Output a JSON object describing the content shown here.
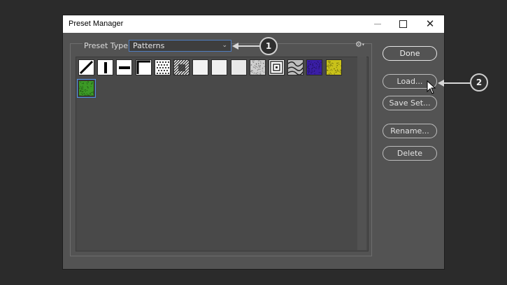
{
  "window": {
    "title": "Preset Manager",
    "controls": {
      "minimize": "–",
      "maximize": "□",
      "close": "✕"
    }
  },
  "preset": {
    "label": "Preset Type:",
    "value": "Patterns",
    "chevron": "⌄",
    "gear_icon": "⚙",
    "gear_dropdown": "▾"
  },
  "swatches": [
    {
      "name": "diagonal-line",
      "bg": "#ffffff",
      "style": "diag"
    },
    {
      "name": "vertical-bar",
      "bg": "#ffffff",
      "style": "vbar"
    },
    {
      "name": "horizontal-bar",
      "bg": "#ffffff",
      "style": "hbar"
    },
    {
      "name": "corner-frame",
      "bg": "#ffffff",
      "style": "corner"
    },
    {
      "name": "dots",
      "bg": "#ffffff",
      "style": "dots"
    },
    {
      "name": "diagonal-stripes",
      "bg": "#ffffff",
      "style": "stripes"
    },
    {
      "name": "light-noise-1",
      "bg": "#f3f3f3",
      "style": "plain"
    },
    {
      "name": "light-noise-2",
      "bg": "#f0f0f0",
      "style": "plain"
    },
    {
      "name": "light-noise-3",
      "bg": "#e8e8e8",
      "style": "plain"
    },
    {
      "name": "gray-noise",
      "bg": "#cfcfcf",
      "style": "noise"
    },
    {
      "name": "concentric-squares",
      "bg": "#ffffff",
      "style": "squares"
    },
    {
      "name": "marble",
      "bg": "#bdbdbd",
      "style": "marble"
    },
    {
      "name": "purple-texture",
      "bg": "#3a1ea6",
      "style": "noise"
    },
    {
      "name": "yellow-texture",
      "bg": "#c9c21a",
      "style": "noise"
    },
    {
      "name": "green-texture",
      "bg": "#3c9a26",
      "style": "noise",
      "selected": true
    }
  ],
  "buttons": {
    "done": "Done",
    "load": "Load...",
    "save_set": "Save Set...",
    "rename": "Rename...",
    "delete": "Delete"
  },
  "callouts": {
    "one": "1",
    "two": "2"
  }
}
